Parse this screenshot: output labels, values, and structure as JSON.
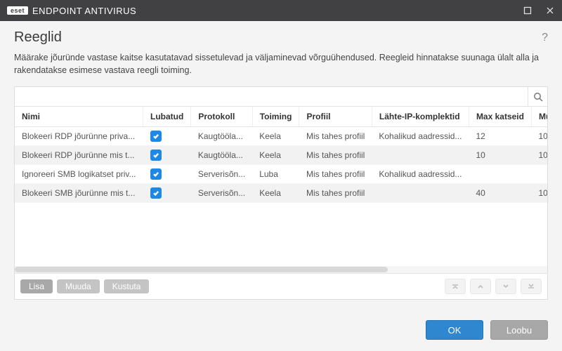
{
  "titlebar": {
    "brand_badge": "eset",
    "product": "ENDPOINT ANTIVIRUS"
  },
  "page": {
    "title": "Reeglid",
    "help_symbol": "?",
    "description": "Määrake jõuründe vastase kaitse kasutatavad sissetulevad ja väljaminevad võrguühendused. Reegleid hinnatakse suunaga ülalt alla ja rakendatakse esimese vastava reegli toiming."
  },
  "search": {
    "placeholder": ""
  },
  "columns": {
    "name": "Nimi",
    "enabled": "Lubatud",
    "protocol": "Protokoll",
    "action": "Toiming",
    "profile": "Profiil",
    "source_ip": "Lähte-IP-komplektid",
    "max_attempts": "Max katseid",
    "blacklist": "Mustas nim"
  },
  "rows": [
    {
      "name": "Blokeeri RDP jõurünne priva...",
      "enabled": true,
      "protocol": "Kaugtööla...",
      "action": "Keela",
      "profile": "Mis tahes profiil",
      "source_ip": "Kohalikud aadressid...",
      "max_attempts": "12",
      "blacklist": "10"
    },
    {
      "name": "Blokeeri RDP jõurünne mis t...",
      "enabled": true,
      "protocol": "Kaugtööla...",
      "action": "Keela",
      "profile": "Mis tahes profiil",
      "source_ip": "",
      "max_attempts": "10",
      "blacklist": "10"
    },
    {
      "name": "Ignoreeri SMB logikatset priv...",
      "enabled": true,
      "protocol": "Serverisõn...",
      "action": "Luba",
      "profile": "Mis tahes profiil",
      "source_ip": "Kohalikud aadressid...",
      "max_attempts": "",
      "blacklist": ""
    },
    {
      "name": "Blokeeri SMB jõurünne mis t...",
      "enabled": true,
      "protocol": "Serverisõn...",
      "action": "Keela",
      "profile": "Mis tahes profiil",
      "source_ip": "",
      "max_attempts": "40",
      "blacklist": "10"
    }
  ],
  "panel_buttons": {
    "add": "Lisa",
    "edit": "Muuda",
    "delete": "Kustuta"
  },
  "footer": {
    "ok": "OK",
    "cancel": "Loobu"
  }
}
